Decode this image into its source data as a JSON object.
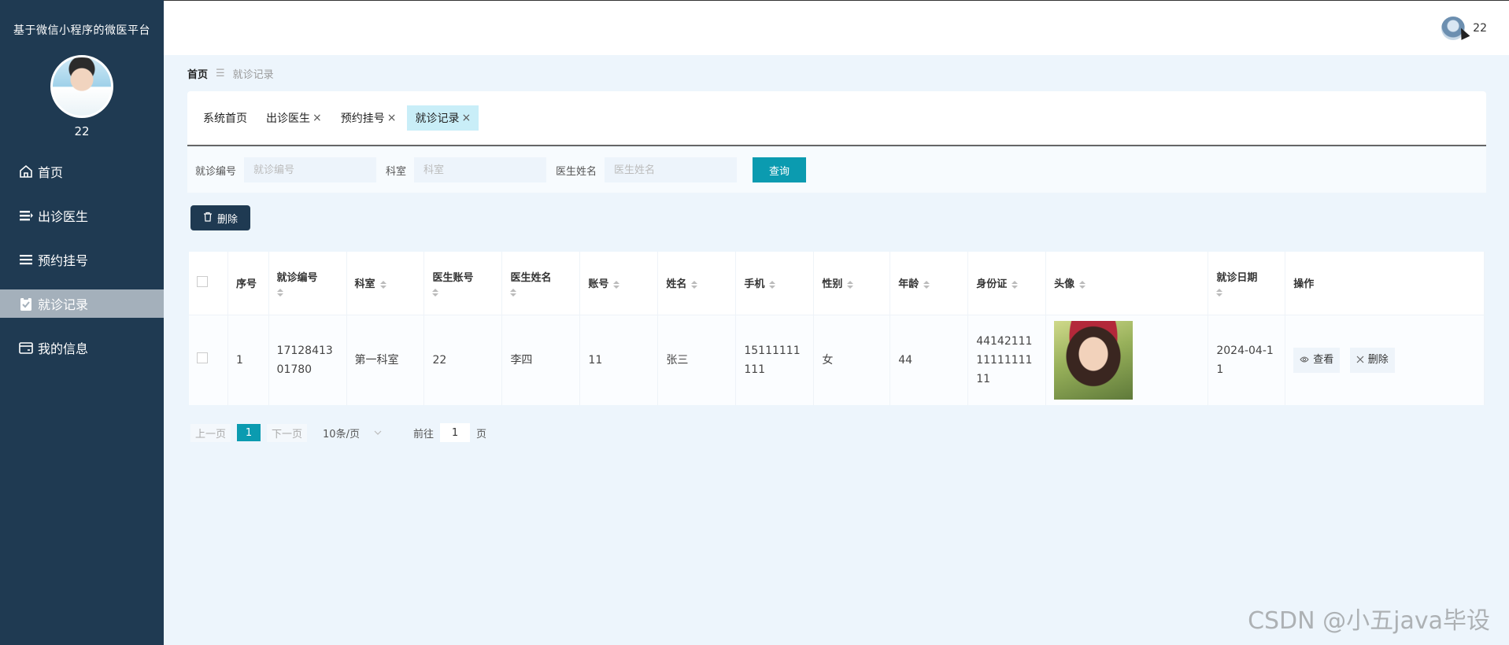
{
  "sidebar": {
    "title": "基于微信小程序的微医平台",
    "user_name": "22",
    "items": [
      {
        "label": "首页",
        "icon": "home-icon"
      },
      {
        "label": "出诊医生",
        "icon": "list-icon"
      },
      {
        "label": "预约挂号",
        "icon": "list-icon"
      },
      {
        "label": "就诊记录",
        "icon": "clipboard-icon",
        "active": true
      },
      {
        "label": "我的信息",
        "icon": "wallet-icon"
      }
    ]
  },
  "header": {
    "user_name": "22"
  },
  "breadcrumb": {
    "home": "首页",
    "separator": "☰",
    "current": "就诊记录"
  },
  "tabs": [
    {
      "label": "系统首页",
      "closable": false
    },
    {
      "label": "出诊医生",
      "closable": true
    },
    {
      "label": "预约挂号",
      "closable": true
    },
    {
      "label": "就诊记录",
      "closable": true,
      "active": true
    }
  ],
  "tab_close": "×",
  "search": {
    "fields": [
      {
        "label": "就诊编号",
        "placeholder": "就诊编号"
      },
      {
        "label": "科室",
        "placeholder": "科室"
      },
      {
        "label": "医生姓名",
        "placeholder": "医生姓名"
      }
    ],
    "query_label": "查询"
  },
  "delete_label": "删除",
  "table": {
    "columns": [
      "序号",
      "就诊编号",
      "科室",
      "医生账号",
      "医生姓名",
      "账号",
      "姓名",
      "手机",
      "性别",
      "年龄",
      "身份证",
      "头像",
      "就诊日期",
      "操作"
    ],
    "rows": [
      {
        "index": "1",
        "visit_no": "1712841301780",
        "department": "第一科室",
        "doctor_account": "22",
        "doctor_name": "李四",
        "account": "11",
        "name": "张三",
        "phone": "15111111111",
        "gender": "女",
        "age": "44",
        "id_card": "441421111111111111",
        "visit_date": "2024-04-11",
        "view_label": "查看",
        "delete_label": "删除"
      }
    ]
  },
  "pagination": {
    "prev": "上一页",
    "current_page": "1",
    "next": "下一页",
    "page_size": "10条/页",
    "goto_label": "前往",
    "goto_value": "1",
    "page_suffix": "页"
  },
  "watermark": "CSDN @小五java毕设",
  "colors": {
    "sidebar": "#1f3a52",
    "accent": "#0b9bb0",
    "active_tab": "#c9eef8"
  }
}
